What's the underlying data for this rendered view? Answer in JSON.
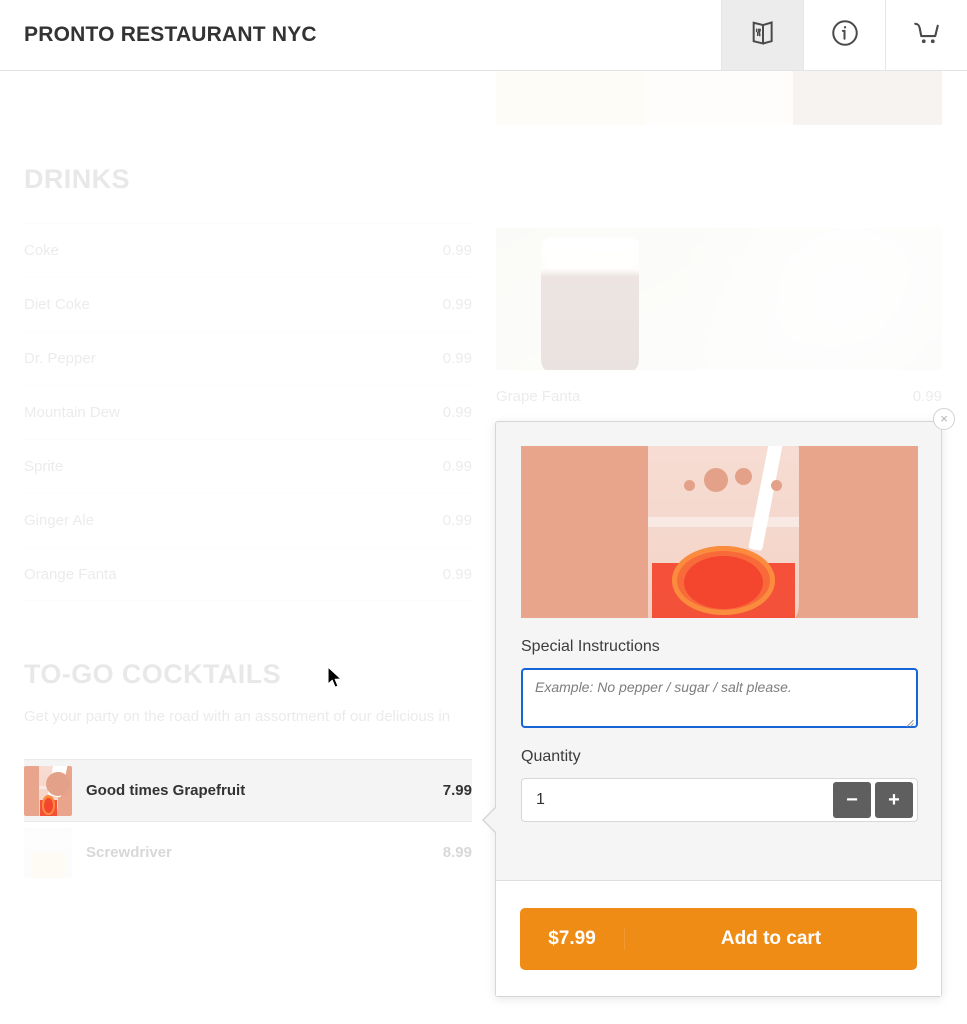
{
  "header": {
    "brand": "PRONTO RESTAURANT NYC",
    "actions": [
      {
        "name": "menu-book-icon",
        "label": "Menu",
        "active": true
      },
      {
        "name": "info-icon",
        "label": "Info",
        "active": false
      },
      {
        "name": "cart-icon",
        "label": "Cart",
        "active": false
      }
    ]
  },
  "sections": [
    {
      "title": "DRINKS",
      "items": [
        {
          "name": "Coke",
          "price": "0.99"
        },
        {
          "name": "Diet Coke",
          "price": "0.99"
        },
        {
          "name": "Dr. Pepper",
          "price": "0.99"
        },
        {
          "name": "Mountain Dew",
          "price": "0.99"
        },
        {
          "name": "Sprite",
          "price": "0.99"
        },
        {
          "name": "Ginger Ale",
          "price": "0.99"
        },
        {
          "name": "Orange Fanta",
          "price": "0.99"
        }
      ]
    },
    {
      "title": "TO-GO COCKTAILS",
      "description": "Get your party on the road with an assortment of our delicious in",
      "items": [
        {
          "name": "Good times Grapefruit",
          "price": "7.99",
          "selected": true
        },
        {
          "name": "Screwdriver",
          "price": "8.99",
          "selected": false
        }
      ]
    }
  ],
  "featured": {
    "name": "Grape Fanta",
    "price": "0.99"
  },
  "modal": {
    "close_label": "×",
    "instructions_label": "Special Instructions",
    "instructions_placeholder": "Example: No pepper / sugar / salt please.",
    "instructions_value": "",
    "quantity_label": "Quantity",
    "quantity_value": "1",
    "decrement_label": "−",
    "increment_label": "+",
    "cart_price": "$7.99",
    "cart_label": "Add to cart"
  },
  "colors": {
    "accent": "#ef8c16",
    "focus": "#1565d8",
    "header_text": "#333333",
    "muted": "#6b6b6b",
    "stepper": "#5f5f5f"
  }
}
